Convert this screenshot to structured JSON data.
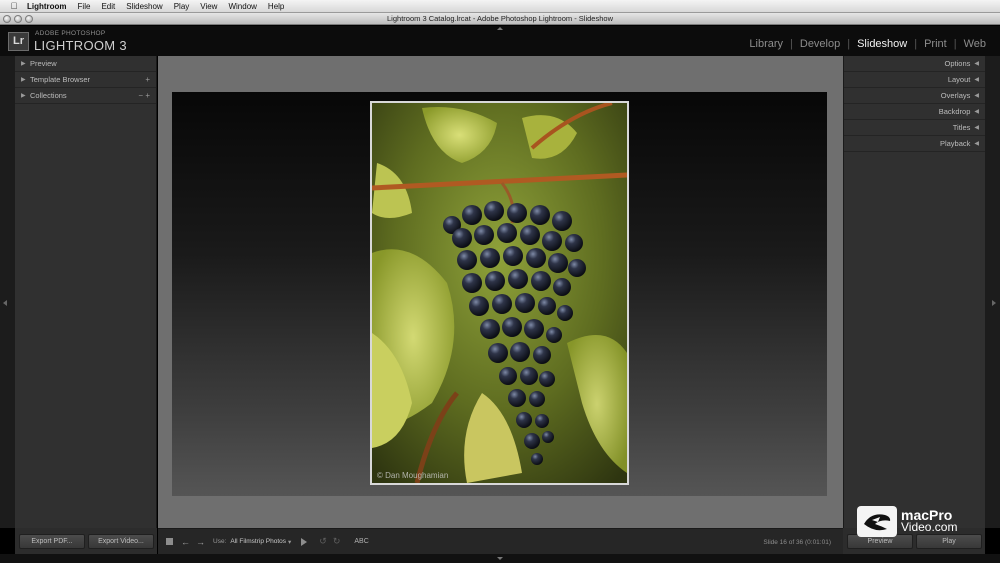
{
  "menubar": {
    "app": "Lightroom",
    "items": [
      "File",
      "Edit",
      "Slideshow",
      "Play",
      "View",
      "Window",
      "Help"
    ]
  },
  "window": {
    "title": "Lightroom 3 Catalog.lrcat - Adobe Photoshop Lightroom - Slideshow"
  },
  "identity": {
    "badge": "Lr",
    "small": "ADOBE PHOTOSHOP",
    "big": "LIGHTROOM 3"
  },
  "modules": [
    {
      "label": "Library",
      "active": false
    },
    {
      "label": "Develop",
      "active": false
    },
    {
      "label": "Slideshow",
      "active": true
    },
    {
      "label": "Print",
      "active": false
    },
    {
      "label": "Web",
      "active": false
    }
  ],
  "left_panels": [
    {
      "label": "Preview",
      "control": ""
    },
    {
      "label": "Template Browser",
      "control": "+"
    },
    {
      "label": "Collections",
      "control": "−  +"
    }
  ],
  "right_panels": [
    "Options",
    "Layout",
    "Overlays",
    "Backdrop",
    "Titles",
    "Playback"
  ],
  "slide": {
    "credit": "© Dan Moughamian"
  },
  "bottom_left": {
    "export_pdf": "Export PDF...",
    "export_video": "Export Video..."
  },
  "toolbar": {
    "use_label": "Use:",
    "use_value": "All Filmstrip Photos",
    "abc": "ABC",
    "slide_count": "Slide 16 of 36 (0:01:01)"
  },
  "bottom_right": {
    "preview": "Preview",
    "play": "Play"
  },
  "watermark": {
    "line1": "macPro",
    "line2": "Video.com"
  }
}
